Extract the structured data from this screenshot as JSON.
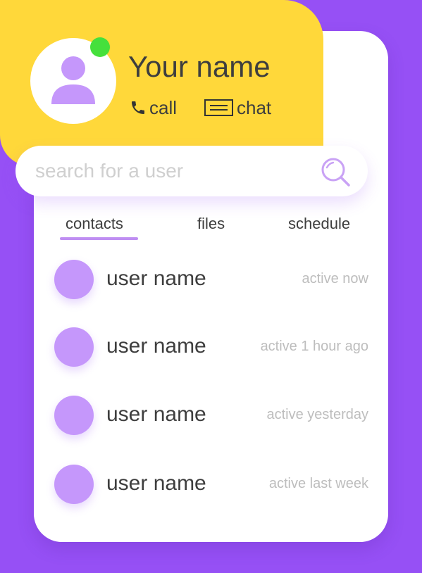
{
  "colors": {
    "background": "#9650F5",
    "card": "#FFFFFF",
    "profile_panel": "#FFD83A",
    "online_status": "#45E03C",
    "accent": "#BF8EF2",
    "user_avatar": "#C597FB"
  },
  "profile": {
    "name": "Your name",
    "status": "online",
    "call_label": "call",
    "chat_label": "chat",
    "call_icon": "phone-icon",
    "chat_icon": "chat-bubble-icon",
    "avatar_icon": "user-silhouette-icon"
  },
  "search": {
    "placeholder": "search for a user",
    "value": "",
    "icon": "search-icon"
  },
  "tabs": {
    "active": "contacts",
    "items": [
      {
        "label": "contacts"
      },
      {
        "label": "files"
      },
      {
        "label": "schedule"
      }
    ]
  },
  "contacts": [
    {
      "name": "user name",
      "status": "active now"
    },
    {
      "name": "user name",
      "status": "active 1 hour ago"
    },
    {
      "name": "user name",
      "status": "active yesterday"
    },
    {
      "name": "user name",
      "status": "active last week"
    }
  ]
}
